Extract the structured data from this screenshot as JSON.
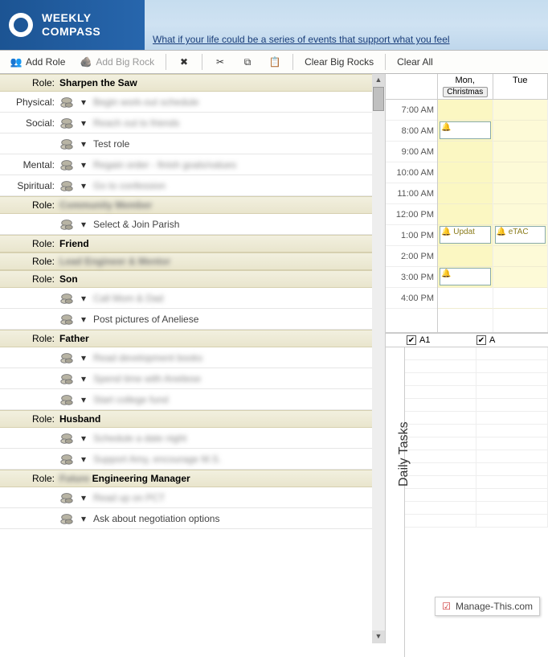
{
  "header": {
    "product_line1": "WEEKLY",
    "product_line2": "COMPASS",
    "tagline": "What if your life could be a series of events that support what you feel"
  },
  "toolbar": {
    "add_role": "Add Role",
    "add_big_rock": "Add Big Rock",
    "clear_big_rocks": "Clear Big Rocks",
    "clear_all": "Clear All"
  },
  "labels": {
    "role": "Role:",
    "physical": "Physical:",
    "social": "Social:",
    "mental": "Mental:",
    "spiritual": "Spiritual:",
    "daily_tasks": "Daily Tasks"
  },
  "roles": [
    {
      "name": "Sharpen the Saw",
      "blur": false,
      "rows": [
        {
          "lbl": "Physical:",
          "text": "Begin work-out schedule",
          "blur": true
        },
        {
          "lbl": "Social:",
          "text": "Reach out to friends",
          "blur": true
        },
        {
          "lbl": "",
          "text": "Test role",
          "blur": false
        },
        {
          "lbl": "Mental:",
          "text": "Regain order - finish goals/values",
          "blur": true
        },
        {
          "lbl": "Spiritual:",
          "text": "Go to confession",
          "blur": true
        }
      ]
    },
    {
      "name": "Community Member",
      "blur": true,
      "rows": [
        {
          "lbl": "",
          "text": "Select & Join Parish",
          "blur": false
        }
      ]
    },
    {
      "name": "Friend",
      "blur": false,
      "rows": []
    },
    {
      "name": "Lead Engineer & Mentor",
      "blur": true,
      "rows": []
    },
    {
      "name": "Son",
      "blur": false,
      "rows": [
        {
          "lbl": "",
          "text": "Call Mom & Dad",
          "blur": true
        },
        {
          "lbl": "",
          "text": "Post pictures of Aneliese",
          "blur": false
        }
      ]
    },
    {
      "name": "Father",
      "blur": false,
      "rows": [
        {
          "lbl": "",
          "text": "Read development books",
          "blur": true
        },
        {
          "lbl": "",
          "text": "Spend time with Aneliese",
          "blur": true
        },
        {
          "lbl": "",
          "text": "Start college fund",
          "blur": true
        }
      ]
    },
    {
      "name": "Husband",
      "blur": false,
      "rows": [
        {
          "lbl": "",
          "text": "Schedule a date night",
          "blur": true
        },
        {
          "lbl": "",
          "text": "Support Amy, encourage M.S.",
          "blur": true
        }
      ]
    },
    {
      "name": "Future Engineering Manager",
      "blur_prefix": true,
      "display": "Engineering Manager",
      "rows": [
        {
          "lbl": "",
          "text": "Read up on PCT",
          "blur": true
        },
        {
          "lbl": "",
          "text": "Ask about negotiation options",
          "blur": false
        }
      ]
    }
  ],
  "calendar": {
    "days": [
      {
        "short": "Mon,",
        "allday": "Christmas"
      },
      {
        "short": "Tue",
        "allday": ""
      }
    ],
    "times": [
      "7:00 AM",
      "8:00 AM",
      "9:00 AM",
      "10:00 AM",
      "11:00 AM",
      "12:00 PM",
      "1:00 PM",
      "2:00 PM",
      "3:00 PM",
      "4:00 PM"
    ],
    "events": {
      "mon": [
        {
          "slot": 1,
          "text": "🔔"
        },
        {
          "slot": 6,
          "text": "🔔 Updat"
        },
        {
          "slot": 8,
          "text": "🔔"
        }
      ],
      "tue": [
        {
          "slot": 6,
          "text": "🔔 eTAC"
        }
      ]
    }
  },
  "tasks": {
    "cols": [
      "A1",
      "A"
    ]
  },
  "watermark": "Manage-This.com"
}
